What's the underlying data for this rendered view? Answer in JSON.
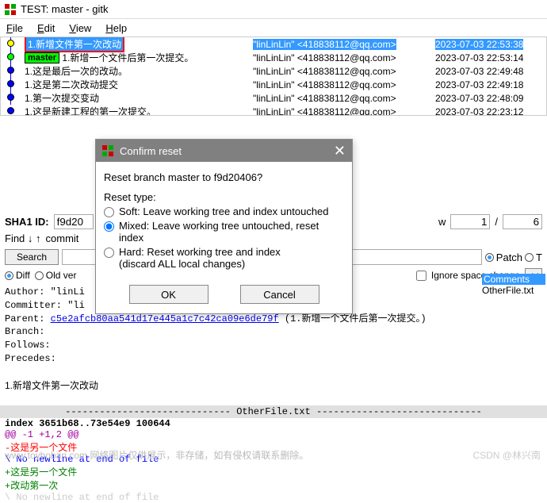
{
  "window": {
    "title": "TEST: master - gitk"
  },
  "menu": {
    "file": "File",
    "edit": "Edit",
    "view": "View",
    "help": "Help"
  },
  "commits": [
    {
      "msg": "1.新增文件第一次改动",
      "author": "\"linLinLin\" <418838112@qq.com>",
      "date": "2023-07-03 22:53:38",
      "selected": true,
      "redbox": true,
      "node": "yellow"
    },
    {
      "msg": "1.新增一个文件后第一次提交。",
      "author": "\"linLinLin\" <418838112@qq.com>",
      "date": "2023-07-03 22:53:14",
      "branch": "master",
      "node": "green"
    },
    {
      "msg": "1.这是最后一次的改动。",
      "author": "\"linLinLin\" <418838112@qq.com>",
      "date": "2023-07-03 22:49:48",
      "node": "blue"
    },
    {
      "msg": "1.这是第二次改动提交",
      "author": "\"linLinLin\" <418838112@qq.com>",
      "date": "2023-07-03 22:49:18",
      "node": "blue"
    },
    {
      "msg": "1.第一次提交变动",
      "author": "\"linLinLin\" <418838112@qq.com>",
      "date": "2023-07-03 22:48:09",
      "node": "blue"
    },
    {
      "msg": "1.这是新建工程的第一次提交。",
      "author": "\"linLinLin\" <418838112@qq.com>",
      "date": "2023-07-03 22:23:12",
      "node": "blue"
    }
  ],
  "sha": {
    "label": "SHA1 ID:",
    "value": "f9d20",
    "pos": "1",
    "total": "6"
  },
  "find": {
    "label": "Find ↓ ↑",
    "type": "commit"
  },
  "search": {
    "btn": "Search"
  },
  "options": {
    "diff": "Diff",
    "oldver": "Old ver",
    "ignorespace": "Ignore space change",
    "patch": "Patch",
    "comments": "Comments",
    "otherfile": "OtherFile.txt"
  },
  "detail": {
    "author": "Author: \"linLi",
    "committer": "Committer: \"li",
    "parent_label": "Parent:",
    "parent_hash": "c5e2afcb80aa541d17e445a1c7c42ca09e6de79f",
    "parent_msg": "(1.新增一个文件后第一次提交。)",
    "branch": "Branch:",
    "follows": "Follows:",
    "precedes": "Precedes:",
    "subject": "1.新增文件第一次改动"
  },
  "diff": {
    "file_header": "----------------------------- OtherFile.txt -----------------------------",
    "index": "index 3651b68..73e54e9 100644",
    "hunk": "@@ -1 +1,2 @@",
    "del": "-这是另一个文件",
    "nnl1": "\\ No newline at end of file",
    "add1": "+这是另一个文件",
    "add2": "+改动第一次",
    "nnl2": "\\ No newline at end of file"
  },
  "dialog": {
    "title": "Confirm reset",
    "question": "Reset branch master to f9d20406?",
    "type_label": "Reset type:",
    "soft": "Soft: Leave working tree and index untouched",
    "mixed": "Mixed: Leave working tree untouched, reset index",
    "hard": "Hard: Reset working tree and index",
    "hard2": "(discard ALL local changes)",
    "ok": "OK",
    "cancel": "Cancel"
  },
  "footer": "www.toyhoban.com 网络图片仅供展示，非存储，如有侵权请联系删除。",
  "watermark": "CSDN @林兴南"
}
